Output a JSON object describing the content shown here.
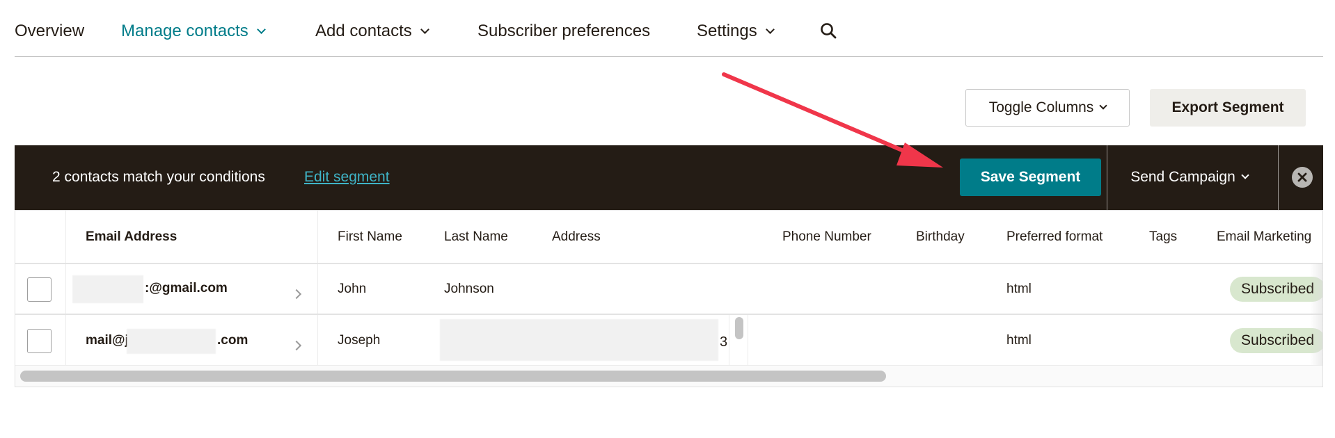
{
  "nav": {
    "items": [
      {
        "label": "Overview",
        "has_dropdown": false,
        "active": false
      },
      {
        "label": "Manage contacts",
        "has_dropdown": true,
        "active": true
      },
      {
        "label": "Add contacts",
        "has_dropdown": true,
        "active": false
      },
      {
        "label": "Subscriber preferences",
        "has_dropdown": false,
        "active": false
      },
      {
        "label": "Settings",
        "has_dropdown": true,
        "active": false
      }
    ],
    "search_icon": "search-icon"
  },
  "actions": {
    "toggle_columns_label": "Toggle Columns",
    "export_segment_label": "Export Segment"
  },
  "banner": {
    "match_text": "2 contacts match your conditions",
    "edit_link": "Edit segment",
    "save_label": "Save Segment",
    "send_label": "Send Campaign",
    "close_icon": "close-icon"
  },
  "table": {
    "columns": [
      "Email Address",
      "First Name",
      "Last Name",
      "Address",
      "Phone Number",
      "Birthday",
      "Preferred format",
      "Tags",
      "Email Marketing"
    ],
    "rows": [
      {
        "email_visible": ":@gmail.com",
        "first_name": "John",
        "last_name": "Johnson",
        "address": "",
        "phone": "",
        "birthday": "",
        "format": "html",
        "tags": "",
        "status": "Subscribed"
      },
      {
        "email_prefix": "mail@j",
        "email_suffix": ".com",
        "first_name": "Joseph",
        "last_name": "",
        "address_tail": "3",
        "phone": "",
        "birthday": "",
        "format": "html",
        "tags": "",
        "status": "Subscribed"
      }
    ]
  },
  "colors": {
    "accent": "#007c89",
    "banner_bg": "#241c15",
    "link": "#3fb4c7",
    "badge_bg": "#d8e7ce",
    "annotation_arrow": "#f0364a"
  }
}
